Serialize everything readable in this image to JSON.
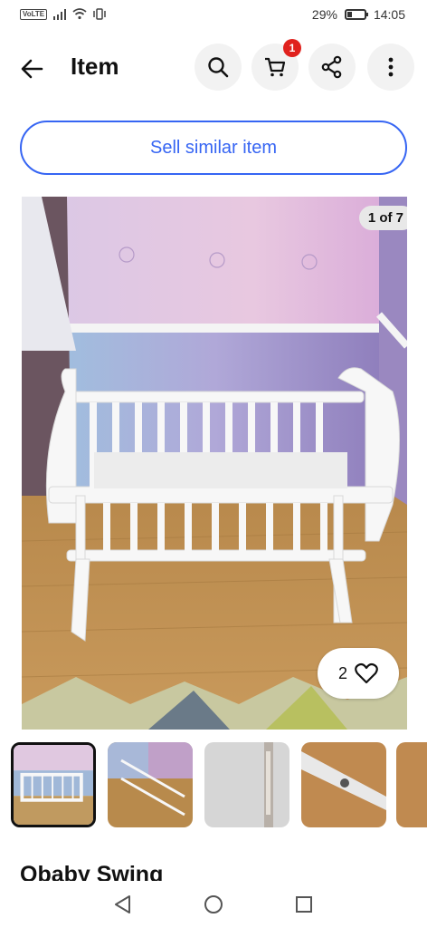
{
  "status_bar": {
    "network": "VoLTE",
    "battery_text": "29%",
    "battery_level": 0.29,
    "time": "14:05"
  },
  "header": {
    "title": "Item",
    "back_icon": "arrow-left-icon",
    "search_icon": "search-icon",
    "cart_icon": "cart-icon",
    "cart_badge": "1",
    "share_icon": "share-icon",
    "more_icon": "more-vertical-icon"
  },
  "sell_button": {
    "label": "Sell similar item",
    "color": "#3665f3"
  },
  "gallery": {
    "counter": "1 of 7",
    "likes": "2",
    "heart_icon": "heart-outline-icon"
  },
  "thumbnails": [
    {
      "name": "thumb-1",
      "selected": true
    },
    {
      "name": "thumb-2",
      "selected": false
    },
    {
      "name": "thumb-3",
      "selected": false
    },
    {
      "name": "thumb-4",
      "selected": false
    },
    {
      "name": "thumb-5",
      "selected": false
    }
  ],
  "product": {
    "title": "Obaby Swing"
  },
  "navbar": {
    "back": "nav-back-icon",
    "home": "nav-home-icon",
    "recents": "nav-recents-icon"
  }
}
